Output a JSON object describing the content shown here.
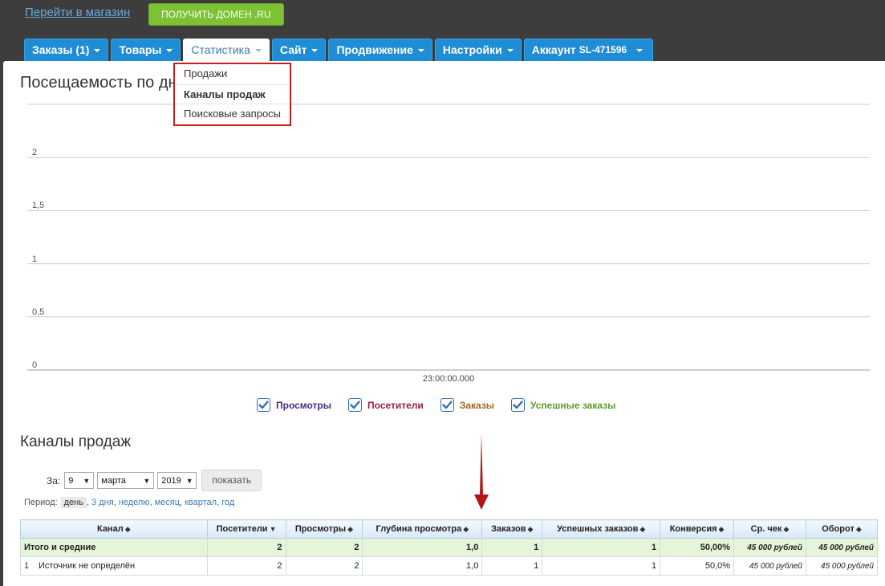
{
  "header": {
    "store_link": "Перейти в магазин",
    "domain_button": "Получить домен .RU"
  },
  "tabs": [
    {
      "label": "Заказы (1)",
      "active": false
    },
    {
      "label": "Товары",
      "active": false
    },
    {
      "label": "Статистика",
      "active": true
    },
    {
      "label": "Сайт",
      "active": false
    },
    {
      "label": "Продвижение",
      "active": false
    },
    {
      "label": "Настройки",
      "active": false
    },
    {
      "label": "Аккаунт",
      "extra": "SL-471596",
      "active": false
    }
  ],
  "dropdown": {
    "items": [
      "Продажи",
      "Каналы продаж",
      "Поисковые запросы"
    ]
  },
  "traffic": {
    "title": "Посещаемость по дн"
  },
  "chart_data": {
    "type": "line",
    "x": [
      "23:00:00.000"
    ],
    "ylim": [
      0,
      2.5
    ],
    "yticks": [
      "0",
      "0,5",
      "1",
      "1,5",
      "2"
    ],
    "series": [
      {
        "name": "Просмотры",
        "values": [],
        "color": "#4a2a84"
      },
      {
        "name": "Посетители",
        "values": [],
        "color": "#9b1b4a"
      },
      {
        "name": "Заказы",
        "values": [],
        "color": "#a3662a"
      },
      {
        "name": "Успешные заказы",
        "values": [],
        "color": "#5b9a2e"
      }
    ],
    "grid": true,
    "legend": "bottom"
  },
  "sales": {
    "title": "Каналы продаж",
    "filter_label": "За:",
    "day": "9",
    "month": "марта",
    "year": "2019",
    "show_button": "показать",
    "period_label": "Период:",
    "period_current": "день",
    "period_links": [
      "3 дня",
      "неделю",
      "месяц",
      "квартал",
      "год"
    ]
  },
  "table": {
    "columns": [
      "Канал",
      "Посетители",
      "Просмотры",
      "Глубина просмотра",
      "Заказов",
      "Успешных заказов",
      "Конверсия",
      "Ср. чек",
      "Оборот"
    ],
    "total": {
      "label": "Итого и средние",
      "cells": [
        "2",
        "2",
        "1,0",
        "1",
        "1",
        "50,00%",
        "45 000 рублей",
        "45 000 рублей"
      ]
    },
    "rows": [
      {
        "num": "1",
        "label": "Источник не определён",
        "cells": [
          "2",
          "2",
          "1,0",
          "1",
          "1",
          "50,0%",
          "45 000 рублей",
          "45 000 рублей"
        ]
      }
    ]
  },
  "colors": {
    "tab_bg": "#1f8dd6",
    "accent_green": "#7cc234",
    "dropdown_border": "#c51f1f",
    "total_row_bg": "#e4f5d9"
  }
}
